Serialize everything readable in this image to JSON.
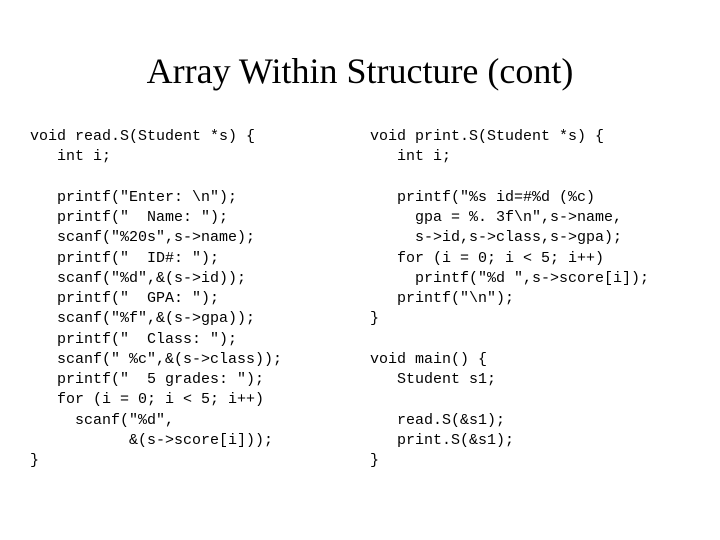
{
  "title": "Array Within Structure (cont)",
  "left": {
    "l0": "void read.S(Student *s) {",
    "l1": "   int i;",
    "l2": "",
    "l3": "   printf(\"Enter: \\n\");",
    "l4": "   printf(\"  Name: \");",
    "l5": "   scanf(\"%20s\",s->name);",
    "l6": "   printf(\"  ID#: \");",
    "l7": "   scanf(\"%d\",&(s->id));",
    "l8": "   printf(\"  GPA: \");",
    "l9": "   scanf(\"%f\",&(s->gpa));",
    "l10": "   printf(\"  Class: \");",
    "l11": "   scanf(\" %c\",&(s->class));",
    "l12": "   printf(\"  5 grades: \");",
    "l13": "   for (i = 0; i < 5; i++)",
    "l14": "     scanf(\"%d\",",
    "l15": "           &(s->score[i]));",
    "l16": "}"
  },
  "right": {
    "l0": "void print.S(Student *s) {",
    "l1": "   int i;",
    "l2": "",
    "l3": "   printf(\"%s id=#%d (%c)",
    "l4": "     gpa = %. 3f\\n\",s->name,",
    "l5": "     s->id,s->class,s->gpa);",
    "l6": "   for (i = 0; i < 5; i++)",
    "l7": "     printf(\"%d \",s->score[i]);",
    "l8": "   printf(\"\\n\");",
    "l9": "}",
    "l10": "",
    "l11": "void main() {",
    "l12": "   Student s1;",
    "l13": "",
    "l14": "   read.S(&s1);",
    "l15": "   print.S(&s1);",
    "l16": "}"
  }
}
